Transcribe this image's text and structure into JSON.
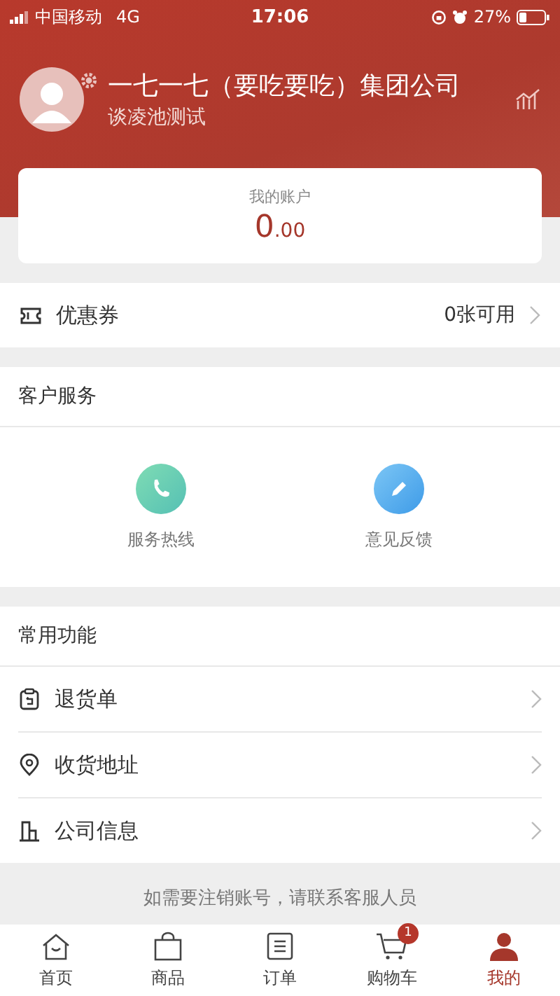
{
  "status_bar": {
    "carrier": "中国移动",
    "network": "4G",
    "time": "17:06",
    "battery": "27%"
  },
  "profile": {
    "company": "一七一七（要吃要吃）集团公司",
    "user": "谈凌池测试"
  },
  "account": {
    "label": "我的账户",
    "amount_int": "0",
    "amount_dec": ".00"
  },
  "coupon": {
    "label": "优惠券",
    "value": "0张可用"
  },
  "customer_service": {
    "title": "客户服务",
    "items": [
      {
        "kind": "phone",
        "label": "服务热线"
      },
      {
        "kind": "edit",
        "label": "意见反馈"
      }
    ]
  },
  "functions": {
    "title": "常用功能",
    "items": [
      {
        "kind": "return",
        "label": "退货单"
      },
      {
        "kind": "location",
        "label": "收货地址"
      },
      {
        "kind": "company",
        "label": "公司信息"
      }
    ]
  },
  "notice": "如需要注销账号，请联系客服人员",
  "tabs": [
    {
      "kind": "home",
      "label": "首页",
      "selected": false
    },
    {
      "kind": "bag",
      "label": "商品",
      "selected": false
    },
    {
      "kind": "order",
      "label": "订单",
      "selected": false
    },
    {
      "kind": "cart",
      "label": "购物车",
      "selected": false,
      "badge": "1"
    },
    {
      "kind": "me",
      "label": "我的",
      "selected": true
    }
  ]
}
